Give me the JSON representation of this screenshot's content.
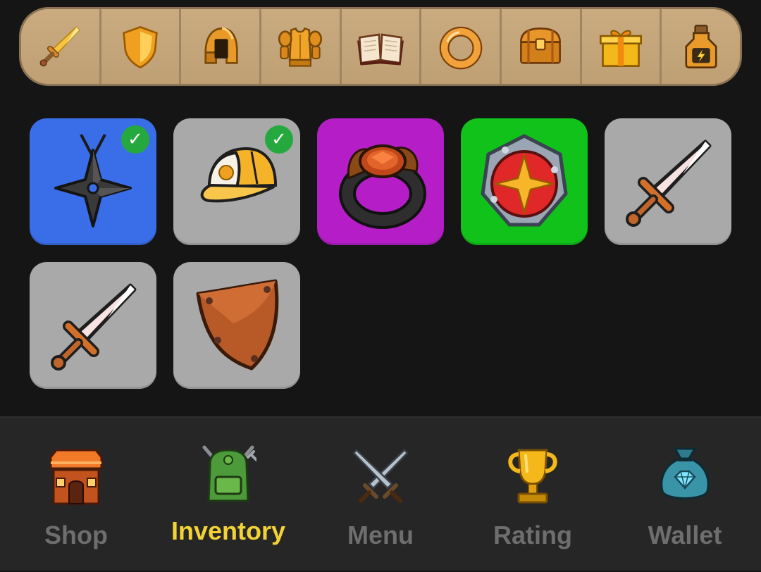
{
  "colors": {
    "slot_blue": "#3a6ee8",
    "slot_grey": "#a9a9a9",
    "slot_purple": "#b51ec7",
    "slot_green": "#10c21a",
    "equipped_check": "#25a93e",
    "nav_active": "#f3d235",
    "nav_inactive": "#6e6e6e"
  },
  "filter_tabs": [
    {
      "icon": "sword-icon"
    },
    {
      "icon": "shield-icon"
    },
    {
      "icon": "helmet-icon"
    },
    {
      "icon": "armor-icon"
    },
    {
      "icon": "book-icon"
    },
    {
      "icon": "ring-icon"
    },
    {
      "icon": "chest-icon"
    },
    {
      "icon": "gift-icon"
    },
    {
      "icon": "potion-icon"
    }
  ],
  "inventory": [
    {
      "icon": "shuriken-amulet-icon",
      "rarity_color": "#3a6ee8",
      "equipped": true,
      "check": "✓"
    },
    {
      "icon": "cap-icon",
      "rarity_color": "#a9a9a9",
      "equipped": true,
      "check": "✓"
    },
    {
      "icon": "ruby-ring-icon",
      "rarity_color": "#b51ec7",
      "equipped": false,
      "check": ""
    },
    {
      "icon": "star-medallion-icon",
      "rarity_color": "#10c21a",
      "equipped": false,
      "check": ""
    },
    {
      "icon": "sword-icon",
      "rarity_color": "#a9a9a9",
      "equipped": false,
      "check": ""
    },
    {
      "icon": "sword-icon",
      "rarity_color": "#a9a9a9",
      "equipped": false,
      "check": ""
    },
    {
      "icon": "leather-shield-icon",
      "rarity_color": "#a9a9a9",
      "equipped": false,
      "check": ""
    }
  ],
  "nav": [
    {
      "label": "Shop",
      "icon": "shop-icon",
      "active": false
    },
    {
      "label": "Inventory",
      "icon": "backpack-icon",
      "active": true
    },
    {
      "label": "Menu",
      "icon": "crossed-swords-icon",
      "active": false
    },
    {
      "label": "Rating",
      "icon": "trophy-icon",
      "active": false
    },
    {
      "label": "Wallet",
      "icon": "money-bag-icon",
      "active": false
    }
  ]
}
